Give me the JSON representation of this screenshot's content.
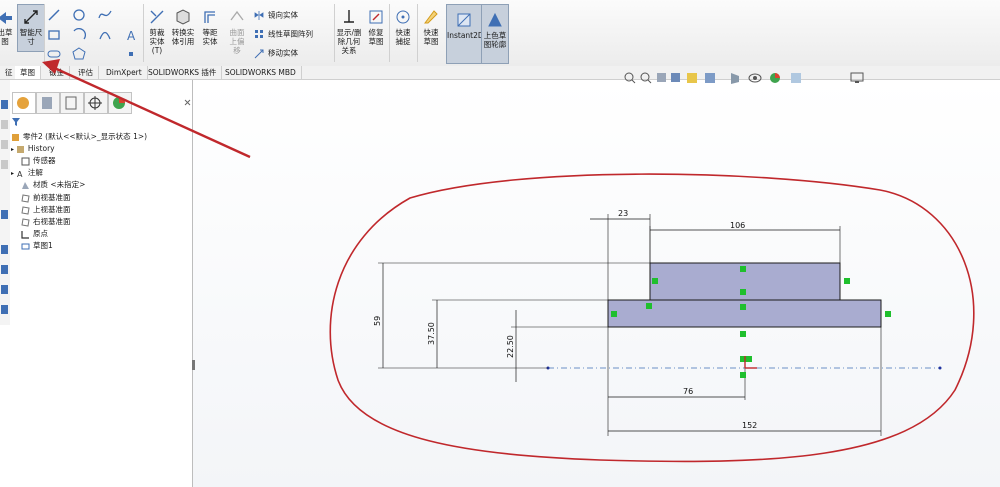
{
  "ribbon": {
    "exit_sketch": "出草图",
    "smart_dimension": "智能尺寸",
    "trim": "剪裁实体(T)",
    "convert": "转换实体引用",
    "offset": "等距实体",
    "surface_offset": "曲面上偏移",
    "mirror": "镜向实体",
    "linear_pattern": "线性草图阵列",
    "move": "移动实体",
    "display_delete": "显示/删除几何关系",
    "repair": "修复草图",
    "quick_snap": "快速捕捉",
    "rapid_sketch": "快速草图",
    "instant2d": "Instant2D",
    "shaded_contours": "上色草图轮廓"
  },
  "tabs": [
    "征",
    "草图",
    "钣金",
    "评估",
    "DimXpert",
    "SOLIDWORKS 插件",
    "SOLIDWORKS MBD"
  ],
  "tree": {
    "root": "零件2 (默认<<默认>_显示状态 1>)",
    "items": [
      "History",
      "传感器",
      "注解",
      "材质 <未指定>",
      "前视基准面",
      "上视基准面",
      "右视基准面",
      "原点",
      "草图1"
    ]
  },
  "dimensions": {
    "d23": "23",
    "d106": "106",
    "d59": "59",
    "d37_50": "37.50",
    "d22_50": "22.50",
    "d76": "76",
    "d152": "152"
  },
  "colors": {
    "accent_blue": "#3f6fb4",
    "annotation_red": "#c0282c",
    "sketch_fill": "#a9acd0",
    "relation_green": "#1fbf2d"
  }
}
